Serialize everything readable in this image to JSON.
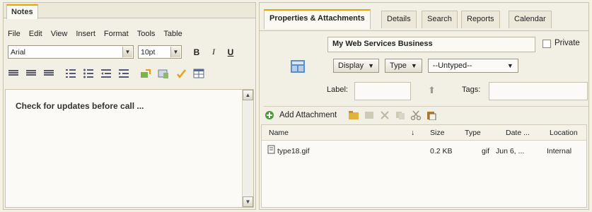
{
  "notes": {
    "tab_label": "Notes",
    "menu": [
      "File",
      "Edit",
      "View",
      "Insert",
      "Format",
      "Tools",
      "Table"
    ],
    "font_name": "Arial",
    "font_size": "10pt",
    "bold_label": "B",
    "italic_label": "I",
    "underline_label": "U",
    "content": "Check for updates before call ..."
  },
  "properties": {
    "tabs": [
      "Properties & Attachments",
      "Details",
      "Search",
      "Reports",
      "Calendar"
    ],
    "title_value": "My Web Services Business",
    "private_label": "Private",
    "display_label": "Display",
    "type_label": "Type",
    "untyped_label": "--Untyped--",
    "label_label": "Label:",
    "tags_label": "Tags:",
    "add_attachment_label": "Add Attachment",
    "columns": {
      "name": "Name",
      "sort_indicator": "↓",
      "size": "Size",
      "type": "Type",
      "date": "Date ...",
      "location": "Location"
    },
    "attachments": [
      {
        "name": "type18.gif",
        "size": "0.2 KB",
        "type": "gif",
        "date": "Jun 6, ...",
        "location": "Internal"
      }
    ]
  },
  "colors": {
    "accent": "#e9a400",
    "panel_bg": "#f2efe4",
    "border": "#c9c3ac"
  }
}
